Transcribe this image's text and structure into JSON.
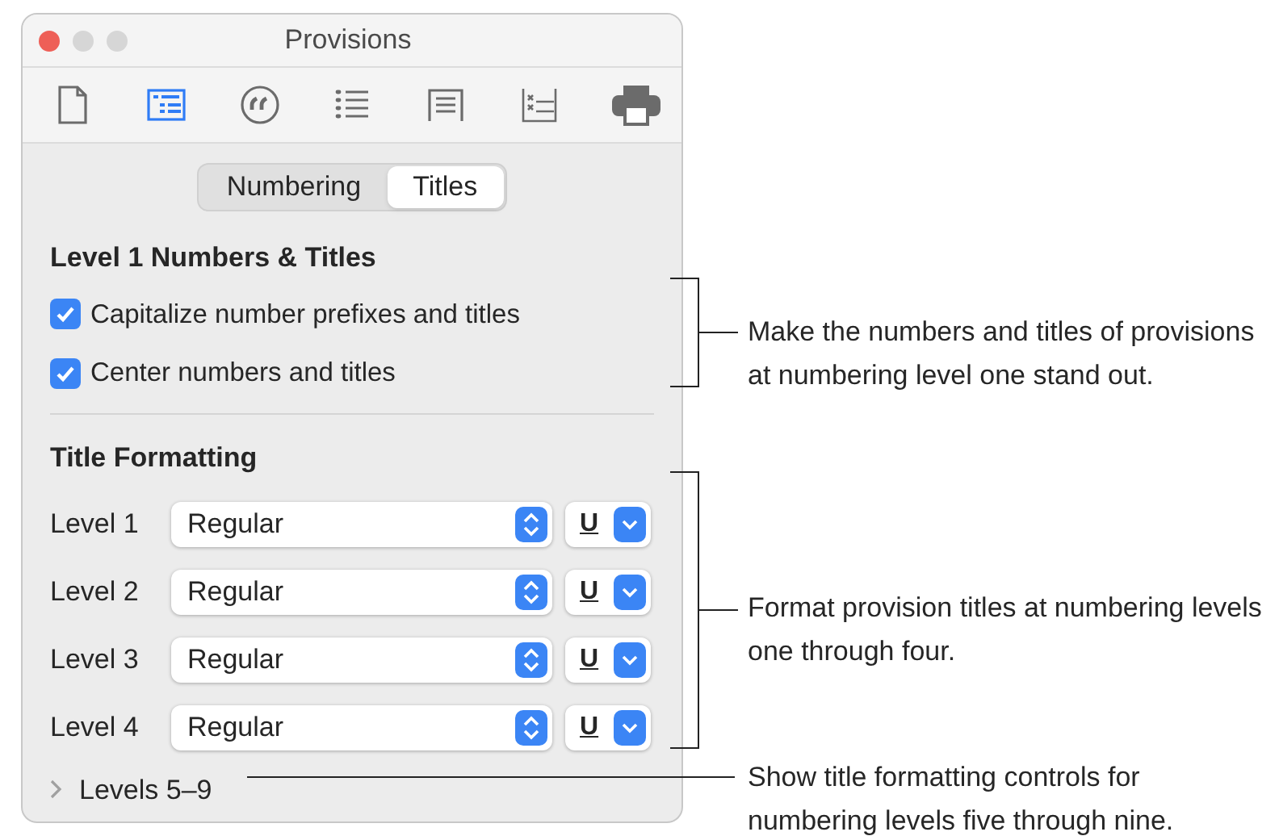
{
  "window": {
    "title": "Provisions"
  },
  "toolbar": [
    {
      "kind": "document",
      "selected": false
    },
    {
      "kind": "numbering",
      "selected": true
    },
    {
      "kind": "quote",
      "selected": false
    },
    {
      "kind": "list",
      "selected": false
    },
    {
      "kind": "text",
      "selected": false
    },
    {
      "kind": "signature",
      "selected": false
    },
    {
      "kind": "printer",
      "selected": false
    }
  ],
  "tabs": [
    {
      "label": "Numbering",
      "selected": false
    },
    {
      "label": "Titles",
      "selected": true
    }
  ],
  "level1_section": {
    "heading": "Level 1 Numbers & Titles",
    "options": [
      {
        "label": "Capitalize number prefixes and titles",
        "checked": true
      },
      {
        "label": "Center numbers and titles",
        "checked": true
      }
    ]
  },
  "title_formatting": {
    "heading": "Title Formatting",
    "rows": [
      {
        "label": "Level 1",
        "style": "Regular",
        "underline": "U"
      },
      {
        "label": "Level 2",
        "style": "Regular",
        "underline": "U"
      },
      {
        "label": "Level 3",
        "style": "Regular",
        "underline": "U"
      },
      {
        "label": "Level 4",
        "style": "Regular",
        "underline": "U"
      }
    ]
  },
  "more_levels": {
    "label": "Levels 5–9",
    "expanded": false
  },
  "callouts": [
    "Make the numbers and titles of provisions at numbering level one stand out.",
    "Format provision titles at numbering levels one through four.",
    "Show title formatting controls for numbering levels five through nine."
  ]
}
